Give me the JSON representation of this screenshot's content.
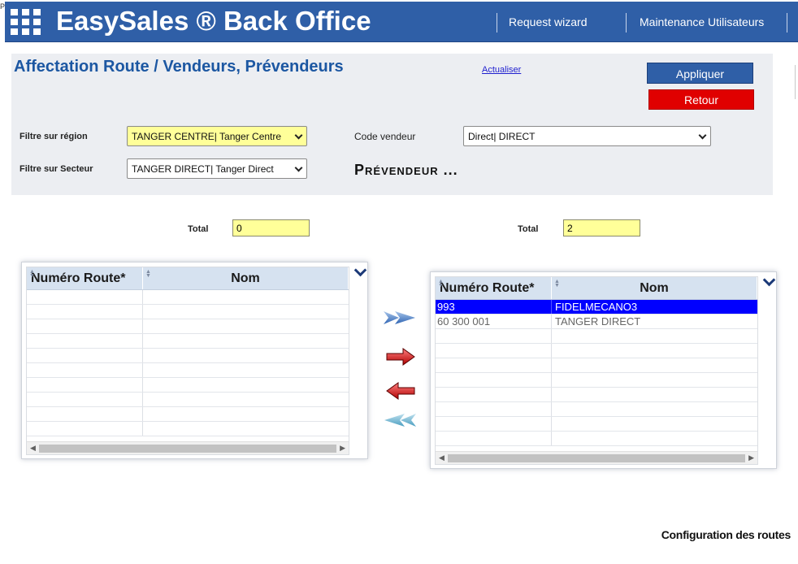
{
  "edge_glyph": "P",
  "header": {
    "title": "EasySales ® Back Office",
    "nav": [
      "Request wizard",
      "Maintenance Utilisateurs"
    ]
  },
  "panel": {
    "title": "Affectation Route / Vendeurs,  Prévendeurs",
    "refresh_link": "Actualiser",
    "apply_label": "Appliquer",
    "back_label": "Retour",
    "region_label": "Filtre sur région",
    "region_value": "TANGER CENTRE| Tanger Centre",
    "sector_label": "Filtre sur Secteur",
    "sector_value": "TANGER DIRECT| Tanger Direct",
    "vendor_label": "Code vendeur",
    "vendor_value": "Direct| DIRECT",
    "section_heading": "Prévendeur ..."
  },
  "totals": {
    "label": "Total",
    "left_value": "0",
    "right_value": "2"
  },
  "grids": {
    "col_route": "Numéro Route*",
    "col_name": "Nom",
    "left_rows": [],
    "right_rows": [
      {
        "route": "993",
        "name": "FIDELMECANO3",
        "selected": true
      },
      {
        "route": "60 300 001",
        "name": "TANGER DIRECT",
        "selected": false
      }
    ]
  },
  "colors": {
    "header_bg": "#2f5fa7",
    "title_blue": "#1c57a2",
    "apply_bg": "#2f5fa7",
    "back_bg": "#e00000",
    "highlight_yellow": "#ffff99",
    "selected_row": "#0000ff"
  },
  "icons": [
    "apps-grid-icon",
    "chevron-down-icon",
    "sort-icon",
    "column-chooser-icon",
    "move-all-right-icon",
    "move-right-icon",
    "move-left-icon",
    "move-all-left-icon"
  ],
  "footer": "Configuration des routes"
}
